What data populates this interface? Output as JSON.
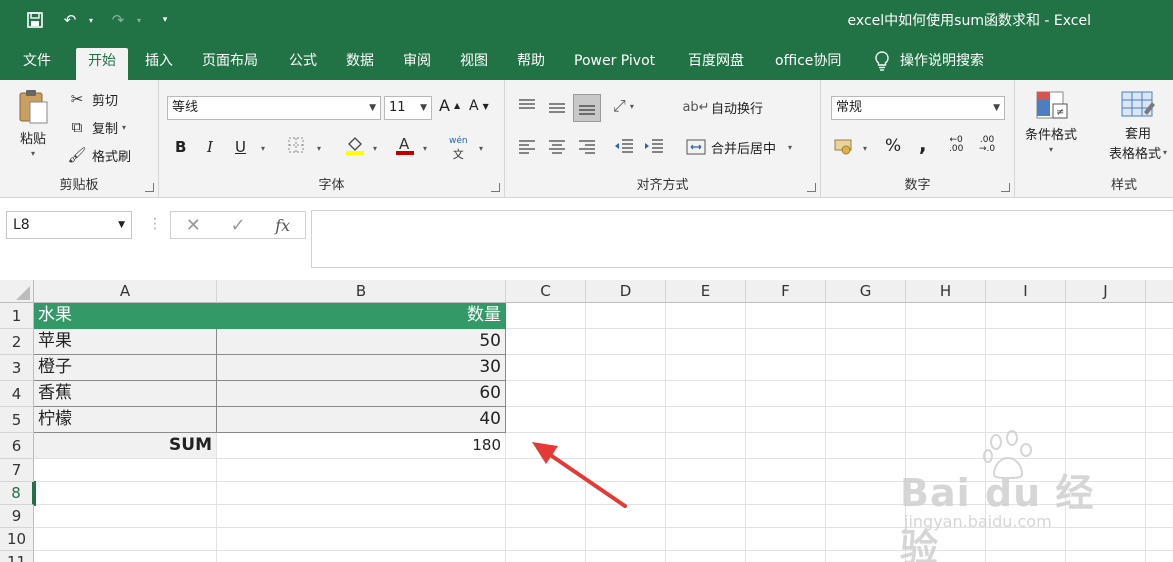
{
  "window": {
    "title": "excel中如何使用sum函数求和  -  Excel"
  },
  "tabs": [
    "文件",
    "开始",
    "插入",
    "页面布局",
    "公式",
    "数据",
    "审阅",
    "视图",
    "帮助",
    "Power Pivot",
    "百度网盘",
    "office协同"
  ],
  "active_tab": "开始",
  "tell_me": "操作说明搜索",
  "ribbon": {
    "clipboard": {
      "label": "剪贴板",
      "paste": "粘贴",
      "cut": "剪切",
      "copy": "复制",
      "format_painter": "格式刷"
    },
    "font": {
      "label": "字体",
      "font_name": "等线",
      "font_size": "11",
      "bold": "B",
      "italic": "I",
      "underline": "U",
      "phonetic": "wén"
    },
    "alignment": {
      "label": "对齐方式",
      "wrap_text": "自动换行",
      "merge_center": "合并后居中"
    },
    "number": {
      "label": "数字",
      "format": "常规",
      "percent": "%",
      "comma": ","
    },
    "styles": {
      "label": "样式",
      "conditional": "条件格式",
      "table_line1": "套用",
      "table_line2": "表格格式"
    }
  },
  "formula_bar": {
    "name_box": "L8",
    "fx": "fx",
    "value": ""
  },
  "columns": [
    "A",
    "B",
    "C",
    "D",
    "E",
    "F",
    "G",
    "H",
    "I",
    "J"
  ],
  "rows": [
    "1",
    "2",
    "3",
    "4",
    "5",
    "6",
    "7",
    "8",
    "9",
    "10",
    "11"
  ],
  "selected_row": "8",
  "table": {
    "header": [
      "水果",
      "数量"
    ],
    "rows": [
      [
        "苹果",
        "50"
      ],
      [
        "橙子",
        "30"
      ],
      [
        "香蕉",
        "60"
      ],
      [
        "柠檬",
        "40"
      ]
    ],
    "sum_label": "SUM",
    "sum_value": "180"
  },
  "colors": {
    "excel_green": "#217346",
    "header_fill": "#339966",
    "arrow": "#e53935"
  },
  "watermark": {
    "text": "Bai du 经验",
    "url": "jingyan.baidu.com"
  }
}
